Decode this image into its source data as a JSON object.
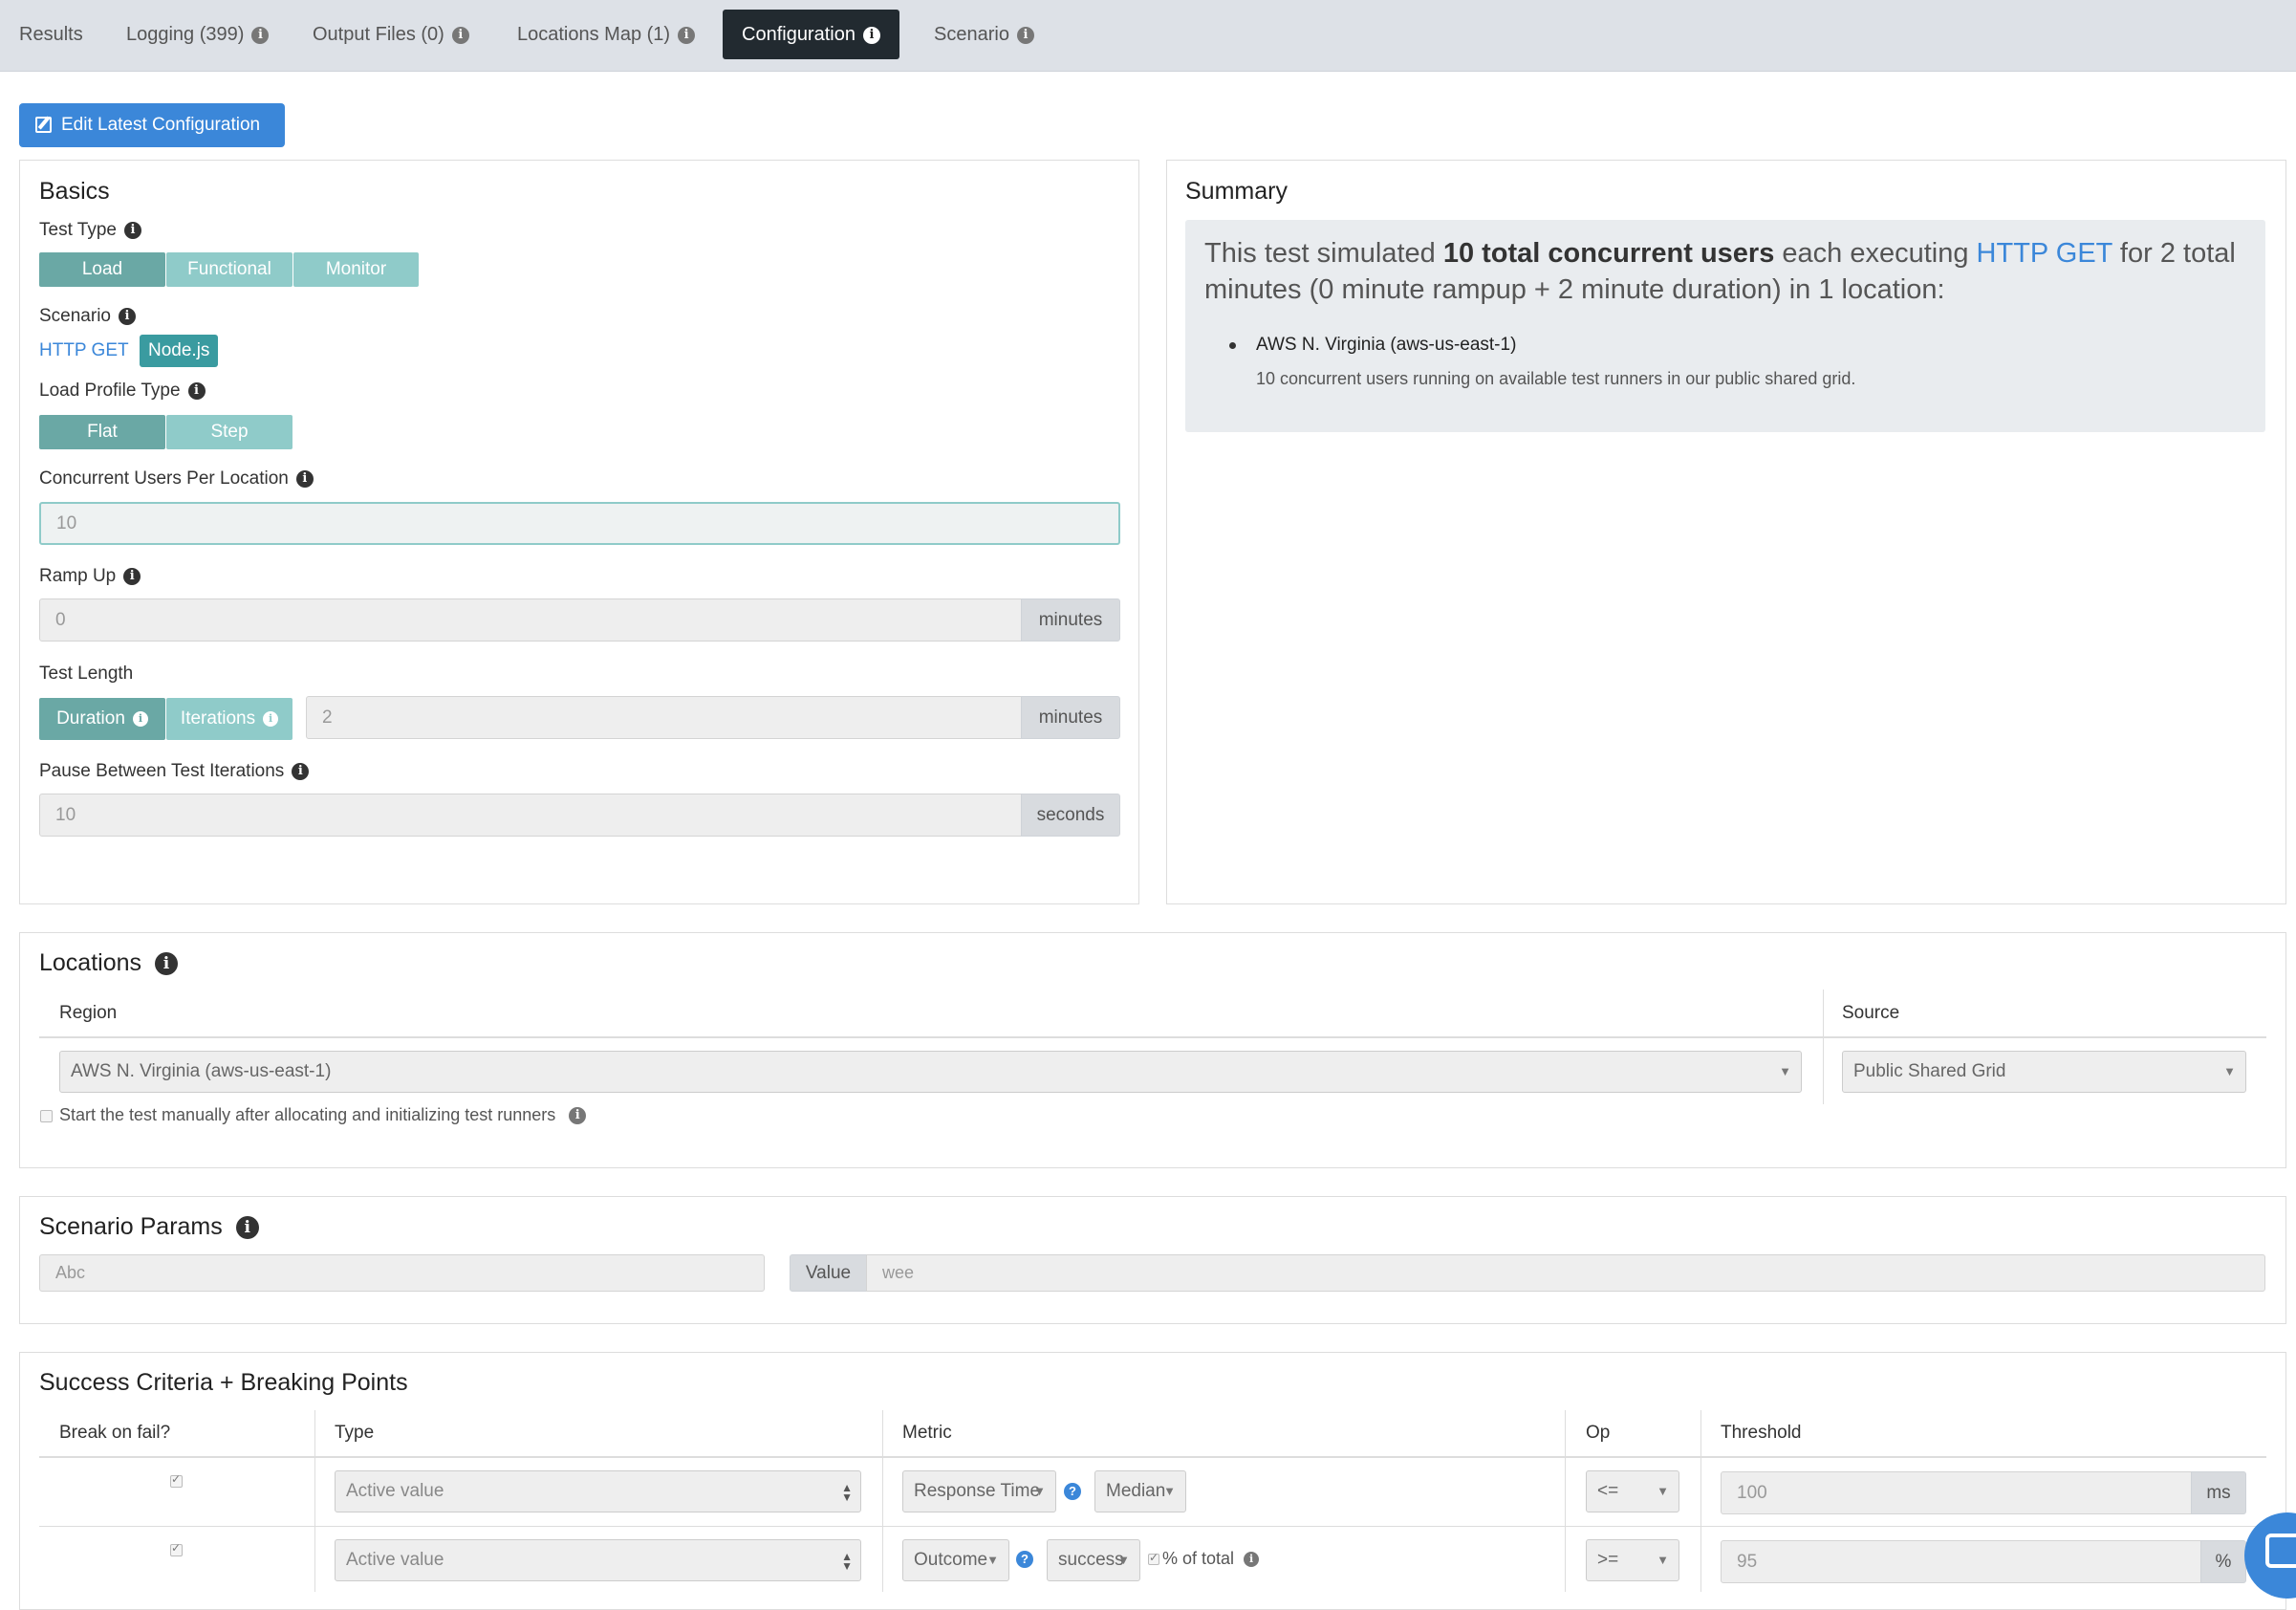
{
  "tabs": [
    {
      "label": "Results",
      "info": false
    },
    {
      "label": "Logging (399)",
      "info": true
    },
    {
      "label": "Output Files (0)",
      "info": true
    },
    {
      "label": "Locations Map (1)",
      "info": true
    },
    {
      "label": "Configuration",
      "info": true,
      "active": true
    },
    {
      "label": "Scenario",
      "info": true
    }
  ],
  "edit_button": {
    "label": "Edit Latest Configuration",
    "icon": "edit-icon"
  },
  "basics": {
    "title": "Basics",
    "test_type": {
      "label": "Test Type",
      "options": [
        "Load",
        "Functional",
        "Monitor"
      ],
      "selected": "Load"
    },
    "scenario": {
      "label": "Scenario",
      "link": "HTTP GET",
      "badge": "Node.js"
    },
    "load_profile": {
      "label": "Load Profile Type",
      "options": [
        "Flat",
        "Step"
      ],
      "selected": "Flat"
    },
    "concurrent_users": {
      "label": "Concurrent Users Per Location",
      "value": "10"
    },
    "ramp_up": {
      "label": "Ramp Up",
      "value": "0",
      "unit": "minutes"
    },
    "test_length": {
      "label": "Test Length",
      "options": [
        "Duration",
        "Iterations"
      ],
      "selected": "Duration",
      "value": "2",
      "unit": "minutes"
    },
    "pause": {
      "label": "Pause Between Test Iterations",
      "value": "10",
      "unit": "seconds"
    }
  },
  "summary": {
    "title": "Summary",
    "text_1": "This test simulated ",
    "text_bold": "10 total concurrent users",
    "text_2": " each executing ",
    "text_link": "HTTP GET",
    "text_3": " for 2 total minutes (0 minute rampup + 2 minute duration) in 1 location:",
    "location_name": "AWS N. Virginia (aws-us-east-1)",
    "location_detail": "10 concurrent users running on available test runners in our public shared grid."
  },
  "locations": {
    "title": "Locations",
    "col_region": "Region",
    "col_source": "Source",
    "region_value": "AWS N. Virginia (aws-us-east-1)",
    "source_value": "Public Shared Grid",
    "manual_start_label": "Start the test manually after allocating and initializing test runners"
  },
  "scenario_params": {
    "title": "Scenario Params",
    "name_value": "Abc",
    "value_label": "Value",
    "value_value": "wee"
  },
  "success_criteria": {
    "title": "Success Criteria + Breaking Points",
    "columns": [
      "Break on fail?",
      "Type",
      "Metric",
      "Op",
      "Threshold"
    ],
    "rows": [
      {
        "type": "Active value",
        "metric": "Response Time",
        "aggregate": "Median",
        "extra": "",
        "op": "<=",
        "threshold": "100",
        "unit": "ms"
      },
      {
        "type": "Active value",
        "metric": "Outcome",
        "aggregate": "success",
        "extra": "% of total",
        "op": ">=",
        "threshold": "95",
        "unit": "%"
      }
    ]
  },
  "colors": {
    "accent": "#3b87d9",
    "toggle_on": "#6aa8a5",
    "toggle_off": "#8fcbc9",
    "badge": "#3a9ba0",
    "tab_active": "#222a30"
  }
}
